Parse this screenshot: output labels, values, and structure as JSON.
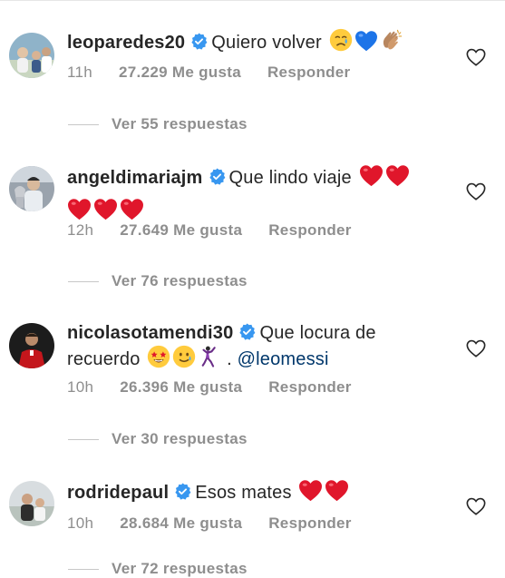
{
  "comments": [
    {
      "username": "leoparedes20",
      "text": "Quiero volver",
      "emojis": [
        "crying-face",
        "blue-heart",
        "clapping-hands"
      ],
      "time": "11h",
      "likes": "27.229 Me gusta",
      "reply_label": "Responder",
      "replies_label": "Ver 55 respuestas"
    },
    {
      "username": "angeldimariajm",
      "text": "Que lindo viaje",
      "emojis": [
        "red-heart",
        "red-heart",
        "red-heart",
        "red-heart",
        "red-heart"
      ],
      "time": "12h",
      "likes": "27.649 Me gusta",
      "reply_label": "Responder",
      "replies_label": "Ver 76 respuestas"
    },
    {
      "username": "nicolasotamendi30",
      "text_line1": "Que locura de",
      "text_line2": "recuerdo",
      "emojis": [
        "star-struck",
        "smiling-tear",
        "dancer"
      ],
      "separator": ".",
      "mention": "@leomessi",
      "time": "10h",
      "likes": "26.396 Me gusta",
      "reply_label": "Responder",
      "replies_label": "Ver 30 respuestas"
    },
    {
      "username": "rodridepaul",
      "text": "Esos mates",
      "emojis": [
        "red-heart",
        "red-heart"
      ],
      "time": "10h",
      "likes": "28.684 Me gusta",
      "reply_label": "Responder",
      "replies_label": "Ver 72 respuestas"
    }
  ],
  "colors": {
    "verified": "#3897f0",
    "mention": "#00376b",
    "meta": "#8e8e8e",
    "red_heart": "#e0162b",
    "blue_heart": "#1d74e8"
  }
}
